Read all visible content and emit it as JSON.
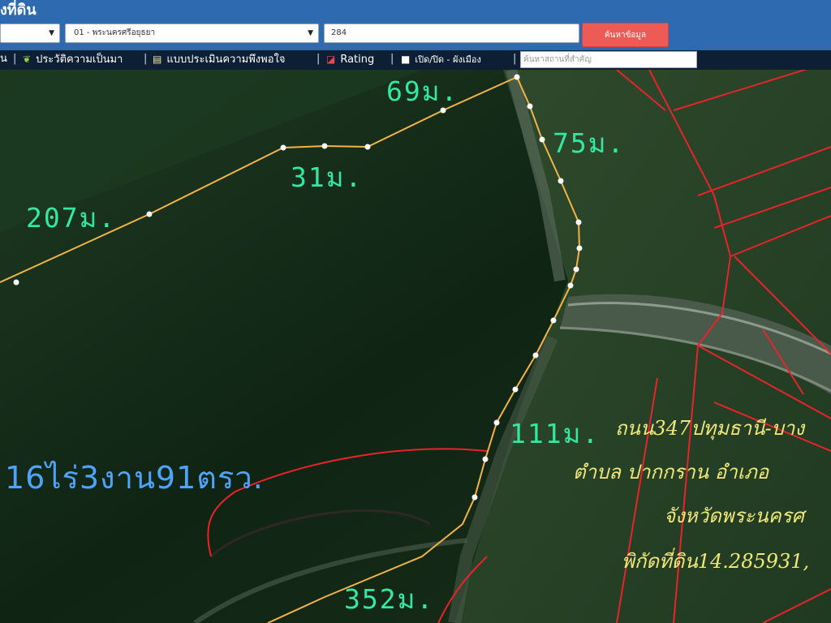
{
  "header": {
    "title": "งที่ดิน",
    "province_select": "",
    "amphoe_select": "01 - พระนครศรีอยุธยา",
    "parcel_number": "284",
    "search_button": "ค้นหาข้อมูล"
  },
  "toolbar": {
    "items": [
      {
        "label": "น",
        "icon": "none"
      },
      {
        "label": "ประวัติความเป็นมา",
        "icon": "sprout-icon"
      },
      {
        "label": "แบบประเมินความพึงพอใจ",
        "icon": "document-icon"
      },
      {
        "label": "Rating",
        "icon": "chart-icon"
      },
      {
        "label": "เปิด/ปิด - ผังเมือง",
        "icon": "square-icon"
      }
    ],
    "place_search_placeholder": "ค้นหาสถานที่สำคัญ"
  },
  "map": {
    "segment_lengths": [
      "69ม.",
      "75ม.",
      "31ม.",
      "207ม.",
      "111ม.",
      "352ม."
    ],
    "area_text": "16ไร่3งาน91ตรว.",
    "road_label": "ถนน347ปทุมธานี-บาง",
    "tambon_label": "ตำบล  ปากกราน  อำเภอ",
    "province_label": "จังหวัดพระนครศ",
    "coordinate_label": "พิกัดที่ดิน14.285931,",
    "colors": {
      "parcel_boundary": "#f4b347",
      "cadastral_lines": "#e8232a",
      "length_text": "#35e8a2",
      "area_text": "#4ea3ff",
      "address_text": "#f1e87a"
    }
  }
}
